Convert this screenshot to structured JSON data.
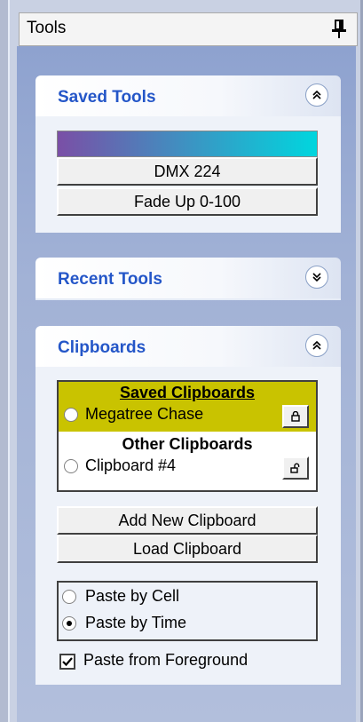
{
  "window": {
    "title": "Tools"
  },
  "saved_tools": {
    "title": "Saved Tools",
    "buttons": [
      "DMX 224",
      "Fade Up 0-100"
    ],
    "gradient_colors": [
      "#7a4fa6",
      "#00d6de"
    ]
  },
  "recent_tools": {
    "title": "Recent Tools"
  },
  "clipboards": {
    "title": "Clipboards",
    "saved_header": "Saved Clipboards",
    "saved_item": "Megatree Chase",
    "other_header": "Other Clipboards",
    "other_item": "Clipboard #4",
    "add_button": "Add New Clipboard",
    "load_button": "Load Clipboard",
    "paste_by_cell": "Paste by Cell",
    "paste_by_time": "Paste by Time",
    "paste_from_foreground": "Paste from Foreground",
    "selected_paste_mode": "Paste by Time",
    "paste_from_foreground_checked": true
  },
  "colors": {
    "heading": "#2456c8",
    "saved_highlight": "#c9c300"
  }
}
